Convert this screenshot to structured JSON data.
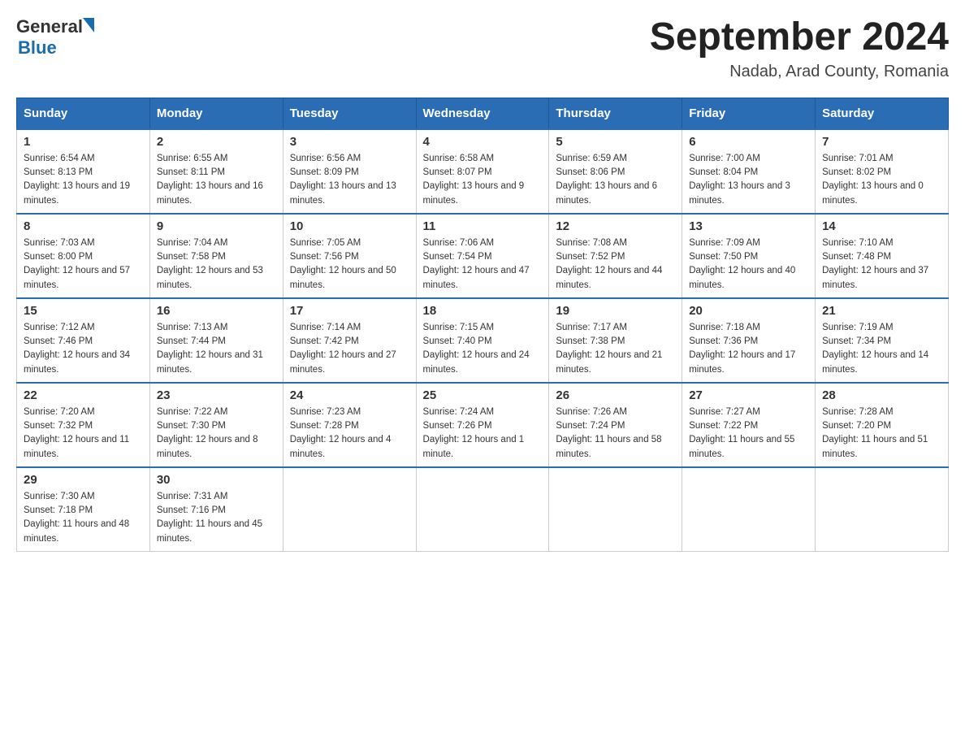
{
  "header": {
    "logo_general": "General",
    "logo_blue": "Blue",
    "month_title": "September 2024",
    "location": "Nadab, Arad County, Romania"
  },
  "days_of_week": [
    "Sunday",
    "Monday",
    "Tuesday",
    "Wednesday",
    "Thursday",
    "Friday",
    "Saturday"
  ],
  "weeks": [
    [
      {
        "day": "1",
        "sunrise": "6:54 AM",
        "sunset": "8:13 PM",
        "daylight": "13 hours and 19 minutes."
      },
      {
        "day": "2",
        "sunrise": "6:55 AM",
        "sunset": "8:11 PM",
        "daylight": "13 hours and 16 minutes."
      },
      {
        "day": "3",
        "sunrise": "6:56 AM",
        "sunset": "8:09 PM",
        "daylight": "13 hours and 13 minutes."
      },
      {
        "day": "4",
        "sunrise": "6:58 AM",
        "sunset": "8:07 PM",
        "daylight": "13 hours and 9 minutes."
      },
      {
        "day": "5",
        "sunrise": "6:59 AM",
        "sunset": "8:06 PM",
        "daylight": "13 hours and 6 minutes."
      },
      {
        "day": "6",
        "sunrise": "7:00 AM",
        "sunset": "8:04 PM",
        "daylight": "13 hours and 3 minutes."
      },
      {
        "day": "7",
        "sunrise": "7:01 AM",
        "sunset": "8:02 PM",
        "daylight": "13 hours and 0 minutes."
      }
    ],
    [
      {
        "day": "8",
        "sunrise": "7:03 AM",
        "sunset": "8:00 PM",
        "daylight": "12 hours and 57 minutes."
      },
      {
        "day": "9",
        "sunrise": "7:04 AM",
        "sunset": "7:58 PM",
        "daylight": "12 hours and 53 minutes."
      },
      {
        "day": "10",
        "sunrise": "7:05 AM",
        "sunset": "7:56 PM",
        "daylight": "12 hours and 50 minutes."
      },
      {
        "day": "11",
        "sunrise": "7:06 AM",
        "sunset": "7:54 PM",
        "daylight": "12 hours and 47 minutes."
      },
      {
        "day": "12",
        "sunrise": "7:08 AM",
        "sunset": "7:52 PM",
        "daylight": "12 hours and 44 minutes."
      },
      {
        "day": "13",
        "sunrise": "7:09 AM",
        "sunset": "7:50 PM",
        "daylight": "12 hours and 40 minutes."
      },
      {
        "day": "14",
        "sunrise": "7:10 AM",
        "sunset": "7:48 PM",
        "daylight": "12 hours and 37 minutes."
      }
    ],
    [
      {
        "day": "15",
        "sunrise": "7:12 AM",
        "sunset": "7:46 PM",
        "daylight": "12 hours and 34 minutes."
      },
      {
        "day": "16",
        "sunrise": "7:13 AM",
        "sunset": "7:44 PM",
        "daylight": "12 hours and 31 minutes."
      },
      {
        "day": "17",
        "sunrise": "7:14 AM",
        "sunset": "7:42 PM",
        "daylight": "12 hours and 27 minutes."
      },
      {
        "day": "18",
        "sunrise": "7:15 AM",
        "sunset": "7:40 PM",
        "daylight": "12 hours and 24 minutes."
      },
      {
        "day": "19",
        "sunrise": "7:17 AM",
        "sunset": "7:38 PM",
        "daylight": "12 hours and 21 minutes."
      },
      {
        "day": "20",
        "sunrise": "7:18 AM",
        "sunset": "7:36 PM",
        "daylight": "12 hours and 17 minutes."
      },
      {
        "day": "21",
        "sunrise": "7:19 AM",
        "sunset": "7:34 PM",
        "daylight": "12 hours and 14 minutes."
      }
    ],
    [
      {
        "day": "22",
        "sunrise": "7:20 AM",
        "sunset": "7:32 PM",
        "daylight": "12 hours and 11 minutes."
      },
      {
        "day": "23",
        "sunrise": "7:22 AM",
        "sunset": "7:30 PM",
        "daylight": "12 hours and 8 minutes."
      },
      {
        "day": "24",
        "sunrise": "7:23 AM",
        "sunset": "7:28 PM",
        "daylight": "12 hours and 4 minutes."
      },
      {
        "day": "25",
        "sunrise": "7:24 AM",
        "sunset": "7:26 PM",
        "daylight": "12 hours and 1 minute."
      },
      {
        "day": "26",
        "sunrise": "7:26 AM",
        "sunset": "7:24 PM",
        "daylight": "11 hours and 58 minutes."
      },
      {
        "day": "27",
        "sunrise": "7:27 AM",
        "sunset": "7:22 PM",
        "daylight": "11 hours and 55 minutes."
      },
      {
        "day": "28",
        "sunrise": "7:28 AM",
        "sunset": "7:20 PM",
        "daylight": "11 hours and 51 minutes."
      }
    ],
    [
      {
        "day": "29",
        "sunrise": "7:30 AM",
        "sunset": "7:18 PM",
        "daylight": "11 hours and 48 minutes."
      },
      {
        "day": "30",
        "sunrise": "7:31 AM",
        "sunset": "7:16 PM",
        "daylight": "11 hours and 45 minutes."
      },
      null,
      null,
      null,
      null,
      null
    ]
  ],
  "labels": {
    "sunrise": "Sunrise:",
    "sunset": "Sunset:",
    "daylight": "Daylight:"
  }
}
